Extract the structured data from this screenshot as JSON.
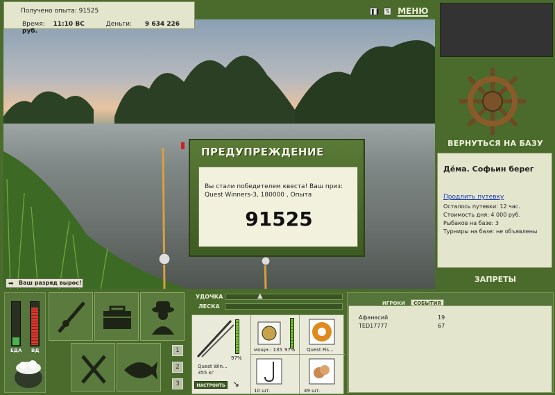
{
  "info": {
    "exp_label": "Получено опыта:",
    "exp_value": "91525",
    "time_label": "Время:",
    "time_value": "11:10 ВС",
    "money_label": "Деньги:",
    "money_value": "9 634 226 руб."
  },
  "topbar": {
    "pause_icon": "pause-icon",
    "sound_icon": "sound-icon",
    "menu_label": "МЕНЮ"
  },
  "right": {
    "return_label": "ВЕРНУТЬСЯ НА БАЗУ",
    "base_name": "Дёма. Софьин берег",
    "extend_link": "Продлить путевку",
    "remaining": "Осталось путевки: 12 час.",
    "day_cost": "Стоимость дня: 4 000 руб.",
    "anglers": "Рыбаков на базе: 3",
    "tournaments": "Турниры на базе: не объявлены",
    "bans_label": "ЗАПРЕТЫ"
  },
  "dialog": {
    "title": "ПРЕДУПРЕЖДЕНИЕ",
    "message": "Вы стали победителем квеста! Ваш приз: Quest Winners-3, 180000 , Опыта",
    "value": "91525"
  },
  "rankup": {
    "text": "Ваш разряд вырос!"
  },
  "gauges": {
    "food_label": "ЕДА",
    "water_label": "ВД",
    "food_level": 0.18,
    "water_level": 0.85
  },
  "slots": {
    "n1": "1",
    "n2": "2",
    "n3": "3"
  },
  "rodbars": {
    "rod_label": "УДОЧКА",
    "line_label": "ЛЕСКА"
  },
  "tackle": {
    "rod_name": "Quest Win...",
    "rod_weight": "355 кг",
    "rod_pct": "97%",
    "reel_power": "мощн.: 135",
    "reel_pct": "97%",
    "line_name": "Quest Fis...",
    "hook_count": "10 шт.",
    "bait_count": "49 шт.",
    "setup_label": "НАСТРОИТЬ"
  },
  "players": {
    "tab_players": "ИГРОКИ",
    "tab_events": "СОБЫТИЯ",
    "list": [
      {
        "name": "Афанасий",
        "value": "19"
      },
      {
        "name": "TED17777",
        "value": "67"
      }
    ]
  },
  "colors": {
    "panel_green": "#4a6b2c",
    "panel_light": "#e4e5cd",
    "accent": "#2d4a18"
  }
}
